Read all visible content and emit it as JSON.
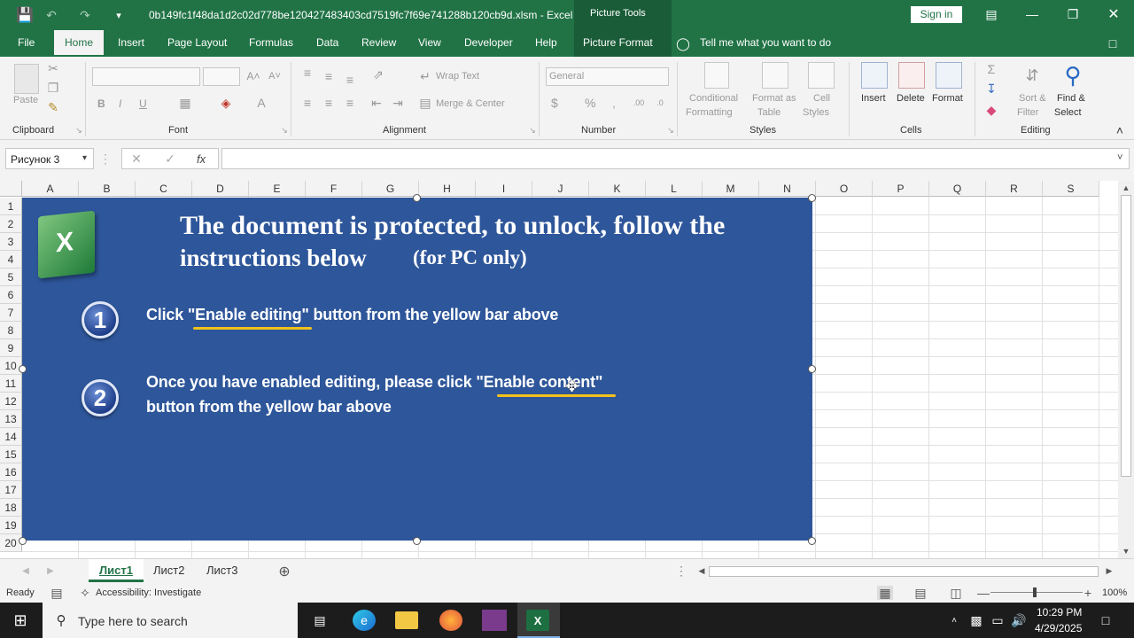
{
  "window": {
    "title": "0b149fc1f48da1d2c02d778be120427483403cd7519fc7f69e741288b120cb9d.xlsm  -  Excel",
    "context_tab_group": "Picture Tools",
    "sign_in": "Sign in"
  },
  "tabs": [
    "File",
    "Home",
    "Insert",
    "Page Layout",
    "Formulas",
    "Data",
    "Review",
    "View",
    "Developer",
    "Help",
    "Picture Format"
  ],
  "tell_me": "Tell me what you want to do",
  "ribbon": {
    "clipboard": {
      "label": "Clipboard",
      "paste": "Paste"
    },
    "font": {
      "label": "Font",
      "bold": "B",
      "italic": "I",
      "underline": "U"
    },
    "alignment": {
      "label": "Alignment",
      "wrap": "Wrap Text",
      "merge": "Merge & Center"
    },
    "number": {
      "label": "Number",
      "format": "General",
      "currency": "$",
      "percent": "%"
    },
    "styles": {
      "label": "Styles",
      "conditional": "Conditional",
      "conditional2": "Formatting",
      "format_table": "Format as",
      "format_table2": "Table",
      "cell_styles": "Cell",
      "cell_styles2": "Styles"
    },
    "cells": {
      "label": "Cells",
      "insert": "Insert",
      "delete": "Delete",
      "format": "Format"
    },
    "editing": {
      "label": "Editing",
      "sort": "Sort &",
      "sort2": "Filter",
      "find": "Find &",
      "find2": "Select"
    }
  },
  "formula_bar": {
    "name_box": "Рисунок 3",
    "fx": "fx",
    "value": ""
  },
  "columns": [
    "A",
    "B",
    "C",
    "D",
    "E",
    "F",
    "G",
    "H",
    "I",
    "J",
    "K",
    "L",
    "M",
    "N",
    "O",
    "P",
    "Q",
    "R",
    "S"
  ],
  "rows": [
    "1",
    "2",
    "3",
    "4",
    "5",
    "6",
    "7",
    "8",
    "9",
    "10",
    "11",
    "12",
    "13",
    "14",
    "15",
    "16",
    "17",
    "18",
    "19",
    "20"
  ],
  "picture": {
    "heading_line1": "The document is protected, to unlock, follow the",
    "heading_line2": "instructions below",
    "heading_suffix": "(for PC only)",
    "step1_num": "1",
    "step1_text": "Click \"Enable editing\" button from the yellow bar above",
    "step2_num": "2",
    "step2_line1": "Once you have enabled editing, please click \"Enable content\"",
    "step2_line2": "button from the yellow bar above",
    "logo_letter": "X"
  },
  "sheet_tabs": [
    "Лист1",
    "Лист2",
    "Лист3"
  ],
  "active_sheet": "Лист1",
  "status": {
    "ready": "Ready",
    "accessibility": "Accessibility: Investigate",
    "zoom": "100%"
  },
  "taskbar": {
    "search_placeholder": "Type here to search",
    "time": "10:29 PM",
    "date": "4/29/2025"
  },
  "colors": {
    "excel_green": "#217346",
    "banner_blue": "#2e569a",
    "underline_yellow": "#f2c21b"
  }
}
